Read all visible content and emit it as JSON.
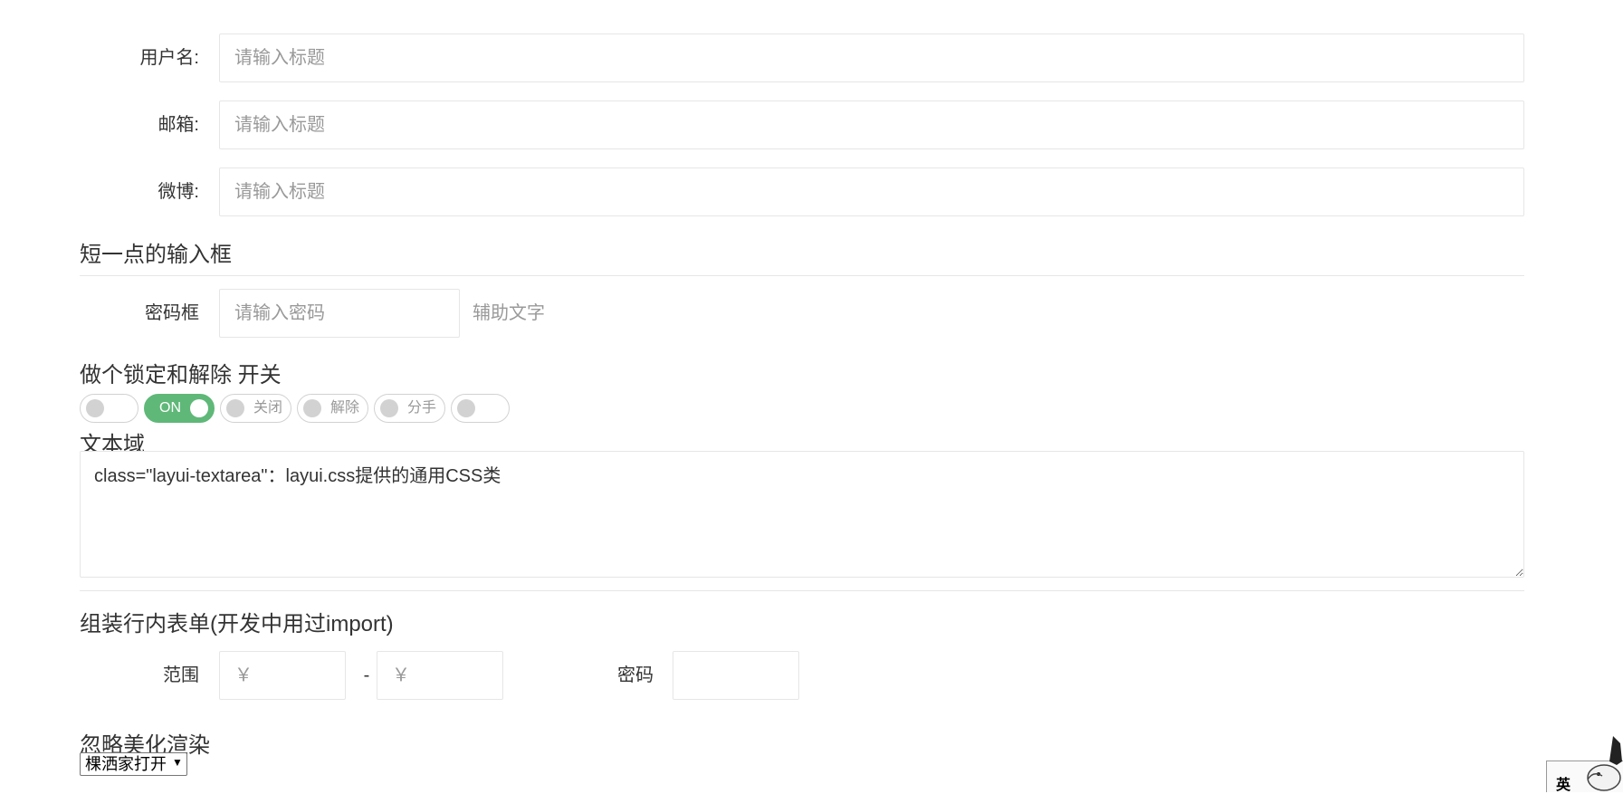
{
  "form": {
    "username": {
      "label": "用户名:",
      "placeholder": "请输入标题"
    },
    "email": {
      "label": "邮箱:",
      "placeholder": "请输入标题"
    },
    "weibo": {
      "label": "微博:",
      "placeholder": "请输入标题"
    }
  },
  "short_input_section": {
    "title": "短一点的输入框",
    "password": {
      "label": "密码框",
      "placeholder": "请输入密码",
      "aux": "辅助文字"
    }
  },
  "switch_section": {
    "title": "做个锁定和解除 开关",
    "switches": [
      {
        "text": "",
        "on": false
      },
      {
        "text": "ON",
        "on": true
      },
      {
        "text": "关闭",
        "on": false
      },
      {
        "text": "解除",
        "on": false
      },
      {
        "text": "分手",
        "on": false
      },
      {
        "text": "",
        "on": false
      }
    ]
  },
  "textarea_section": {
    "title": "文本域",
    "value": "class=\"layui-textarea\"：layui.css提供的通用CSS类"
  },
  "inline_section": {
    "title": "组装行内表单(开发中用过import)",
    "range": {
      "label": "范围",
      "min_placeholder": "￥",
      "separator": "-",
      "max_placeholder": "￥"
    },
    "password": {
      "label": "密码",
      "value": ""
    }
  },
  "ignore_section": {
    "title": "忽略美化渲染",
    "select_value": "棵洒家打开"
  },
  "ime": {
    "label": "英"
  },
  "colors": {
    "accent_green": "#5fb878",
    "border": "#e6e6e6",
    "placeholder": "#999999"
  }
}
